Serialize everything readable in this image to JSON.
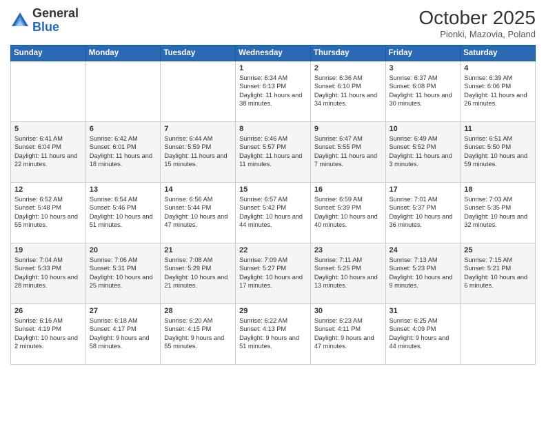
{
  "header": {
    "logo_general": "General",
    "logo_blue": "Blue",
    "month_title": "October 2025",
    "subtitle": "Pionki, Mazovia, Poland"
  },
  "days_of_week": [
    "Sunday",
    "Monday",
    "Tuesday",
    "Wednesday",
    "Thursday",
    "Friday",
    "Saturday"
  ],
  "weeks": [
    [
      {
        "day": "",
        "info": ""
      },
      {
        "day": "",
        "info": ""
      },
      {
        "day": "",
        "info": ""
      },
      {
        "day": "1",
        "info": "Sunrise: 6:34 AM\nSunset: 6:13 PM\nDaylight: 11 hours\nand 38 minutes."
      },
      {
        "day": "2",
        "info": "Sunrise: 6:36 AM\nSunset: 6:10 PM\nDaylight: 11 hours\nand 34 minutes."
      },
      {
        "day": "3",
        "info": "Sunrise: 6:37 AM\nSunset: 6:08 PM\nDaylight: 11 hours\nand 30 minutes."
      },
      {
        "day": "4",
        "info": "Sunrise: 6:39 AM\nSunset: 6:06 PM\nDaylight: 11 hours\nand 26 minutes."
      }
    ],
    [
      {
        "day": "5",
        "info": "Sunrise: 6:41 AM\nSunset: 6:04 PM\nDaylight: 11 hours\nand 22 minutes."
      },
      {
        "day": "6",
        "info": "Sunrise: 6:42 AM\nSunset: 6:01 PM\nDaylight: 11 hours\nand 18 minutes."
      },
      {
        "day": "7",
        "info": "Sunrise: 6:44 AM\nSunset: 5:59 PM\nDaylight: 11 hours\nand 15 minutes."
      },
      {
        "day": "8",
        "info": "Sunrise: 6:46 AM\nSunset: 5:57 PM\nDaylight: 11 hours\nand 11 minutes."
      },
      {
        "day": "9",
        "info": "Sunrise: 6:47 AM\nSunset: 5:55 PM\nDaylight: 11 hours\nand 7 minutes."
      },
      {
        "day": "10",
        "info": "Sunrise: 6:49 AM\nSunset: 5:52 PM\nDaylight: 11 hours\nand 3 minutes."
      },
      {
        "day": "11",
        "info": "Sunrise: 6:51 AM\nSunset: 5:50 PM\nDaylight: 10 hours\nand 59 minutes."
      }
    ],
    [
      {
        "day": "12",
        "info": "Sunrise: 6:52 AM\nSunset: 5:48 PM\nDaylight: 10 hours\nand 55 minutes."
      },
      {
        "day": "13",
        "info": "Sunrise: 6:54 AM\nSunset: 5:46 PM\nDaylight: 10 hours\nand 51 minutes."
      },
      {
        "day": "14",
        "info": "Sunrise: 6:56 AM\nSunset: 5:44 PM\nDaylight: 10 hours\nand 47 minutes."
      },
      {
        "day": "15",
        "info": "Sunrise: 6:57 AM\nSunset: 5:42 PM\nDaylight: 10 hours\nand 44 minutes."
      },
      {
        "day": "16",
        "info": "Sunrise: 6:59 AM\nSunset: 5:39 PM\nDaylight: 10 hours\nand 40 minutes."
      },
      {
        "day": "17",
        "info": "Sunrise: 7:01 AM\nSunset: 5:37 PM\nDaylight: 10 hours\nand 36 minutes."
      },
      {
        "day": "18",
        "info": "Sunrise: 7:03 AM\nSunset: 5:35 PM\nDaylight: 10 hours\nand 32 minutes."
      }
    ],
    [
      {
        "day": "19",
        "info": "Sunrise: 7:04 AM\nSunset: 5:33 PM\nDaylight: 10 hours\nand 28 minutes."
      },
      {
        "day": "20",
        "info": "Sunrise: 7:06 AM\nSunset: 5:31 PM\nDaylight: 10 hours\nand 25 minutes."
      },
      {
        "day": "21",
        "info": "Sunrise: 7:08 AM\nSunset: 5:29 PM\nDaylight: 10 hours\nand 21 minutes."
      },
      {
        "day": "22",
        "info": "Sunrise: 7:09 AM\nSunset: 5:27 PM\nDaylight: 10 hours\nand 17 minutes."
      },
      {
        "day": "23",
        "info": "Sunrise: 7:11 AM\nSunset: 5:25 PM\nDaylight: 10 hours\nand 13 minutes."
      },
      {
        "day": "24",
        "info": "Sunrise: 7:13 AM\nSunset: 5:23 PM\nDaylight: 10 hours\nand 9 minutes."
      },
      {
        "day": "25",
        "info": "Sunrise: 7:15 AM\nSunset: 5:21 PM\nDaylight: 10 hours\nand 6 minutes."
      }
    ],
    [
      {
        "day": "26",
        "info": "Sunrise: 6:16 AM\nSunset: 4:19 PM\nDaylight: 10 hours\nand 2 minutes."
      },
      {
        "day": "27",
        "info": "Sunrise: 6:18 AM\nSunset: 4:17 PM\nDaylight: 9 hours\nand 58 minutes."
      },
      {
        "day": "28",
        "info": "Sunrise: 6:20 AM\nSunset: 4:15 PM\nDaylight: 9 hours\nand 55 minutes."
      },
      {
        "day": "29",
        "info": "Sunrise: 6:22 AM\nSunset: 4:13 PM\nDaylight: 9 hours\nand 51 minutes."
      },
      {
        "day": "30",
        "info": "Sunrise: 6:23 AM\nSunset: 4:11 PM\nDaylight: 9 hours\nand 47 minutes."
      },
      {
        "day": "31",
        "info": "Sunrise: 6:25 AM\nSunset: 4:09 PM\nDaylight: 9 hours\nand 44 minutes."
      },
      {
        "day": "",
        "info": ""
      }
    ]
  ]
}
